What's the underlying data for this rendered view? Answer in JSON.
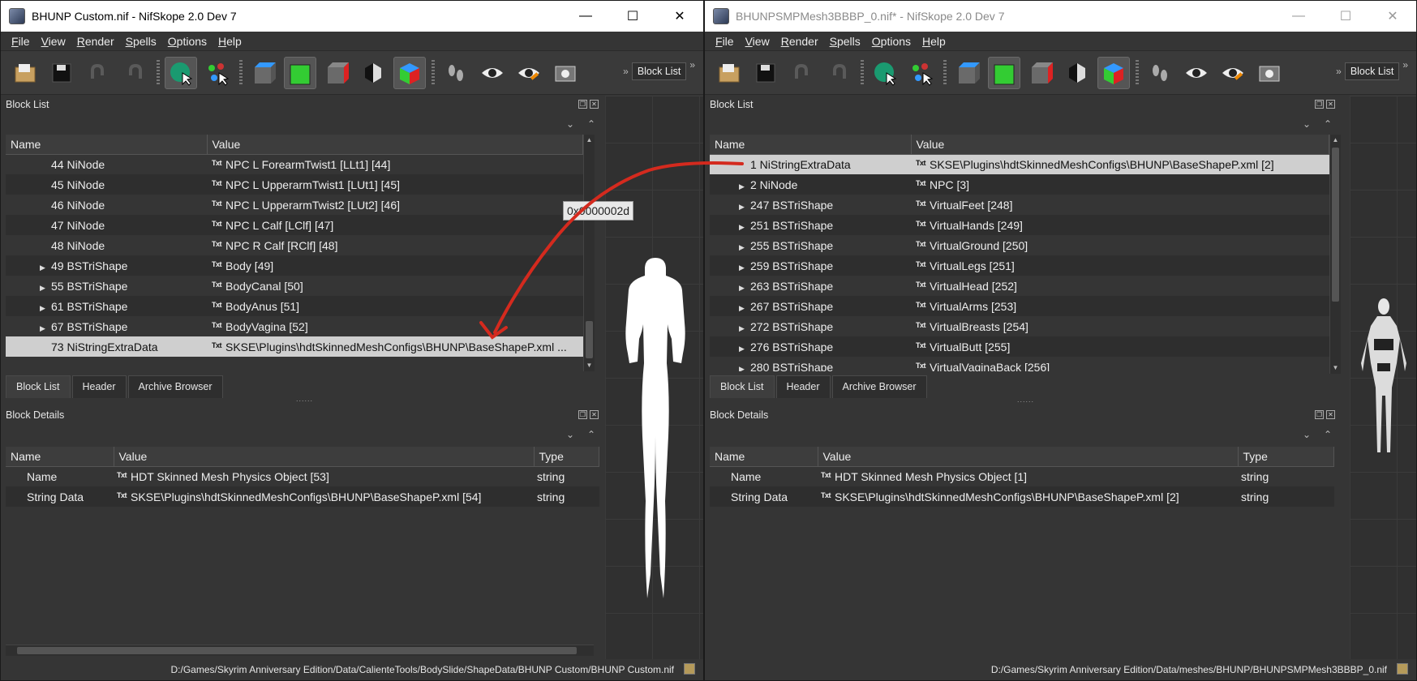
{
  "left": {
    "title": "BHUNP Custom.nif - NifSkope 2.0 Dev 7",
    "menu": [
      [
        "F",
        "ile"
      ],
      [
        "V",
        "iew"
      ],
      [
        "R",
        "ender"
      ],
      [
        "S",
        "pells"
      ],
      [
        "O",
        "ptions"
      ],
      [
        "H",
        "elp"
      ]
    ],
    "toolbar_block_button": "Block List",
    "block_list_title": "Block List",
    "headers": {
      "name": "Name",
      "value": "Value"
    },
    "rows": [
      {
        "name": "44 NiNode",
        "value": "NPC L ForearmTwist1 [LLt1] [44]",
        "expand": false
      },
      {
        "name": "45 NiNode",
        "value": "NPC L UpperarmTwist1 [LUt1] [45]",
        "expand": false
      },
      {
        "name": "46 NiNode",
        "value": "NPC L UpperarmTwist2 [LUt2] [46]",
        "expand": false
      },
      {
        "name": "47 NiNode",
        "value": "NPC L Calf [LClf] [47]",
        "expand": false
      },
      {
        "name": "48 NiNode",
        "value": "NPC R Calf [RClf] [48]",
        "expand": false
      },
      {
        "name": "49 BSTriShape",
        "value": "Body [49]",
        "expand": true
      },
      {
        "name": "55 BSTriShape",
        "value": "BodyCanal [50]",
        "expand": true
      },
      {
        "name": "61 BSTriShape",
        "value": "BodyAnus [51]",
        "expand": true
      },
      {
        "name": "67 BSTriShape",
        "value": "BodyVagina [52]",
        "expand": true
      },
      {
        "name": "73 NiStringExtraData",
        "value": "SKSE\\Plugins\\hdtSkinnedMeshConfigs\\BHUNP\\BaseShapeP.xml ...",
        "expand": false,
        "selected": true
      }
    ],
    "tabs": [
      "Block List",
      "Header",
      "Archive Browser"
    ],
    "details_title": "Block Details",
    "details_headers": {
      "name": "Name",
      "value": "Value",
      "type": "Type"
    },
    "details": [
      {
        "name": "Name",
        "value": "HDT Skinned Mesh Physics Object [53]",
        "type": "string"
      },
      {
        "name": "String Data",
        "value": "SKSE\\Plugins\\hdtSkinnedMeshConfigs\\BHUNP\\BaseShapeP.xml [54]",
        "type": "string"
      }
    ],
    "tooltip": "0x0000002d",
    "status_path": "D:/Games/Skyrim Anniversary Edition/Data/CalienteTools/BodySlide/ShapeData/BHUNP Custom/BHUNP Custom.nif"
  },
  "right": {
    "title": "BHUNPSMPMesh3BBBP_0.nif* - NifSkope 2.0 Dev 7",
    "menu": [
      [
        "F",
        "ile"
      ],
      [
        "V",
        "iew"
      ],
      [
        "R",
        "ender"
      ],
      [
        "S",
        "pells"
      ],
      [
        "O",
        "ptions"
      ],
      [
        "H",
        "elp"
      ]
    ],
    "toolbar_block_button": "Block List",
    "block_list_title": "Block List",
    "headers": {
      "name": "Name",
      "value": "Value"
    },
    "rows": [
      {
        "name": "1 NiStringExtraData",
        "value": "SKSE\\Plugins\\hdtSkinnedMeshConfigs\\BHUNP\\BaseShapeP.xml [2]",
        "expand": false,
        "selected": true
      },
      {
        "name": "2 NiNode",
        "value": "NPC [3]",
        "expand": true
      },
      {
        "name": "247 BSTriShape",
        "value": "VirtualFeet [248]",
        "expand": true
      },
      {
        "name": "251 BSTriShape",
        "value": "VirtualHands [249]",
        "expand": true
      },
      {
        "name": "255 BSTriShape",
        "value": "VirtualGround [250]",
        "expand": true
      },
      {
        "name": "259 BSTriShape",
        "value": "VirtualLegs [251]",
        "expand": true
      },
      {
        "name": "263 BSTriShape",
        "value": "VirtualHead [252]",
        "expand": true
      },
      {
        "name": "267 BSTriShape",
        "value": "VirtualArms [253]",
        "expand": true
      },
      {
        "name": "272 BSTriShape",
        "value": "VirtualBreasts [254]",
        "expand": true
      },
      {
        "name": "276 BSTriShape",
        "value": "VirtualButt [255]",
        "expand": true
      },
      {
        "name": "280 BSTriShape",
        "value": "VirtualVaginaBack [256]",
        "expand": true
      }
    ],
    "tabs": [
      "Block List",
      "Header",
      "Archive Browser"
    ],
    "details_title": "Block Details",
    "details_headers": {
      "name": "Name",
      "value": "Value",
      "type": "Type"
    },
    "details": [
      {
        "name": "Name",
        "value": "HDT Skinned Mesh Physics Object [1]",
        "type": "string"
      },
      {
        "name": "String Data",
        "value": "SKSE\\Plugins\\hdtSkinnedMeshConfigs\\BHUNP\\BaseShapeP.xml [2]",
        "type": "string"
      }
    ],
    "status_path": "D:/Games/Skyrim Anniversary Edition/Data/meshes/BHUNP/BHUNPSMPMesh3BBBP_0.nif"
  },
  "icons": {
    "row_value_icon": "Txt",
    "expand_arrow": "▶",
    "window_minimize": "—",
    "window_maximize": "☐",
    "window_close": "✕",
    "toolbar_overflow": "»"
  },
  "colors": {
    "annotation_arrow": "#d42a1e",
    "selection": "#cfcfcf"
  }
}
